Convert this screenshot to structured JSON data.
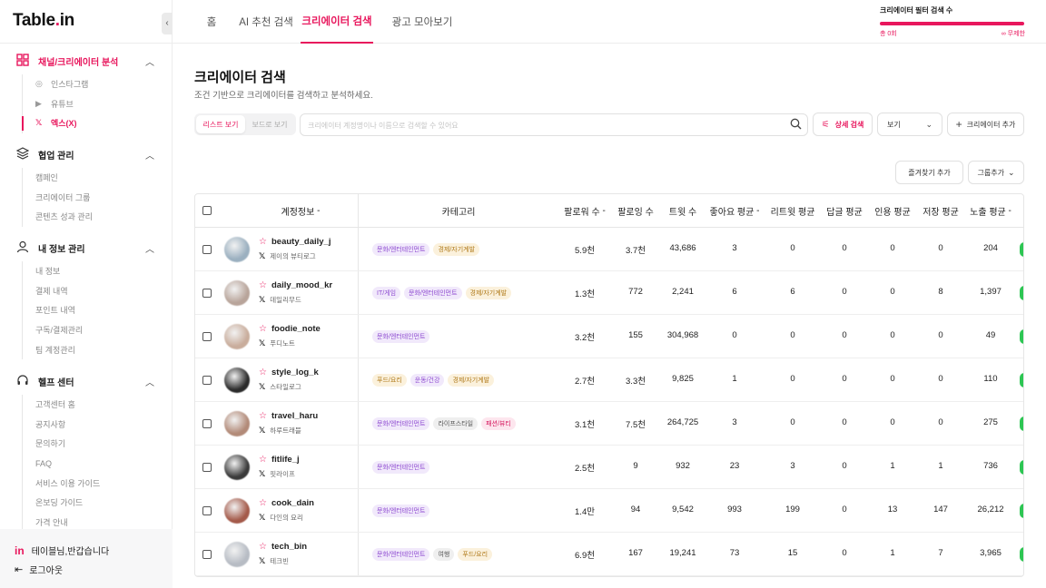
{
  "brand": {
    "logo_main": "Table",
    "logo_dot": ".",
    "logo_tail": "in"
  },
  "sidebar": {
    "sections": [
      {
        "label": "채널/크리에이터 분석",
        "items": [
          {
            "label": "인스타그램",
            "icon": "instagram-icon"
          },
          {
            "label": "유튜브",
            "icon": "youtube-icon"
          },
          {
            "label": "엑스(X)",
            "icon": "x-icon",
            "active": true
          }
        ]
      },
      {
        "label": "협업 관리",
        "items": [
          {
            "label": "캠페인"
          },
          {
            "label": "크리에이터 그룹"
          },
          {
            "label": "콘텐츠 성과 관리"
          }
        ]
      },
      {
        "label": "내 정보 관리",
        "items": [
          {
            "label": "내 정보"
          },
          {
            "label": "결제 내역"
          },
          {
            "label": "포인트 내역"
          },
          {
            "label": "구독/결제관리"
          },
          {
            "label": "팀 계정관리"
          }
        ]
      },
      {
        "label": "헬프 센터",
        "items": [
          {
            "label": "고객센터 홈"
          },
          {
            "label": "공지사항"
          },
          {
            "label": "문의하기"
          },
          {
            "label": "FAQ"
          },
          {
            "label": "서비스 이용 가이드"
          },
          {
            "label": "온보딩 가이드"
          },
          {
            "label": "가격 안내"
          }
        ]
      }
    ],
    "footer": {
      "greeting": "테이블님,반갑습니다",
      "logout": "로그아웃"
    }
  },
  "topnav": {
    "tabs": [
      "홈",
      "AI 추천 검색",
      "크리에이터 검색",
      "광고 모아보기"
    ],
    "active_tab": 2,
    "quota": {
      "title": "크리에이터 필터 검색 수",
      "used": "총 0회",
      "limit": "무제한"
    }
  },
  "main": {
    "title": "크리에이터 검색",
    "subtitle": "조건 기반으로 크리에이터를 검색하고 분석하세요.",
    "view_modes": [
      "리스트 보기",
      "보드로 보기"
    ],
    "search_placeholder": "크리에이터 계정명이나 이름으로 검색할 수 있어요",
    "detail_search": "상세 검색",
    "view_select": "보기",
    "add_creator": "크리에이터 추가",
    "favorites_add": "즐겨찾기 추가",
    "group_add": "그룹추가"
  },
  "table": {
    "columns": [
      "계정정보",
      "카테고리",
      "팔로워 수",
      "팔로잉 수",
      "트윗 수",
      "좋아요 평균",
      "리트윗 평균",
      "답글 평균",
      "인용 평균",
      "저장 평균",
      "노출 평균"
    ],
    "rows": [
      {
        "handle": "beauty_daily_j",
        "name": "제이의 뷰티로그",
        "avatar": "#9bb0c0",
        "tags": [
          [
            "문화/엔터테인먼트",
            "purple"
          ],
          [
            "경제/자기계발",
            "yellow"
          ]
        ],
        "followers": "5.9천",
        "following": "3.7천",
        "tweets": "43,686",
        "likes": "3",
        "retweets": "0",
        "replies": "0",
        "quotes": "0",
        "saves": "0",
        "views": "204"
      },
      {
        "handle": "daily_mood_kr",
        "name": "데일리무드",
        "avatar": "#b8a49a",
        "tags": [
          [
            "IT/게임",
            "purple"
          ],
          [
            "문화/엔터테인먼트",
            "purple"
          ],
          [
            "경제/자기계발",
            "yellow"
          ]
        ],
        "followers": "1.3천",
        "following": "772",
        "tweets": "2,241",
        "likes": "6",
        "retweets": "6",
        "replies": "0",
        "quotes": "0",
        "saves": "8",
        "views": "1,397"
      },
      {
        "handle": "foodie_note",
        "name": "푸디노트",
        "avatar": "#c9ad9c",
        "tags": [
          [
            "문화/엔터테인먼트",
            "purple"
          ]
        ],
        "followers": "3.2천",
        "following": "155",
        "tweets": "304,968",
        "likes": "0",
        "retweets": "0",
        "replies": "0",
        "quotes": "0",
        "saves": "0",
        "views": "49"
      },
      {
        "handle": "style_log_k",
        "name": "스타일로그",
        "avatar": "#2b2b2b",
        "tags": [
          [
            "푸드/요리",
            "yellow"
          ],
          [
            "운동/건강",
            "purple"
          ],
          [
            "경제/자기계발",
            "yellow"
          ]
        ],
        "followers": "2.7천",
        "following": "3.3천",
        "tweets": "9,825",
        "likes": "1",
        "retweets": "0",
        "replies": "0",
        "quotes": "0",
        "saves": "0",
        "views": "110"
      },
      {
        "handle": "travel_haru",
        "name": "하루트래블",
        "avatar": "#b28a78",
        "tags": [
          [
            "문화/엔터테인먼트",
            "purple"
          ],
          [
            "라이프스타일",
            "gray"
          ],
          [
            "패션/뷰티",
            "pink"
          ]
        ],
        "followers": "3.1천",
        "following": "7.5천",
        "tweets": "264,725",
        "likes": "3",
        "retweets": "0",
        "replies": "0",
        "quotes": "0",
        "saves": "0",
        "views": "275"
      },
      {
        "handle": "fitlife_j",
        "name": "핏라이프",
        "avatar": "#3a3a3a",
        "tags": [
          [
            "문화/엔터테인먼트",
            "purple"
          ]
        ],
        "followers": "2.5천",
        "following": "9",
        "tweets": "932",
        "likes": "23",
        "retweets": "3",
        "replies": "0",
        "quotes": "1",
        "saves": "1",
        "views": "736"
      },
      {
        "handle": "cook_dain",
        "name": "다인의 요리",
        "avatar": "#a45a4a",
        "tags": [
          [
            "문화/엔터테인먼트",
            "purple"
          ]
        ],
        "followers": "1.4만",
        "following": "94",
        "tweets": "9,542",
        "likes": "993",
        "retweets": "199",
        "replies": "0",
        "quotes": "13",
        "saves": "147",
        "views": "26,212"
      },
      {
        "handle": "tech_bin",
        "name": "테크빈",
        "avatar": "#b7bcc4",
        "tags": [
          [
            "문화/엔터테인먼트",
            "purple"
          ],
          [
            "여행",
            "gray"
          ],
          [
            "푸드/요리",
            "yellow"
          ]
        ],
        "followers": "6.9천",
        "following": "167",
        "tweets": "19,241",
        "likes": "73",
        "retweets": "15",
        "replies": "0",
        "quotes": "1",
        "saves": "7",
        "views": "3,965"
      }
    ]
  }
}
